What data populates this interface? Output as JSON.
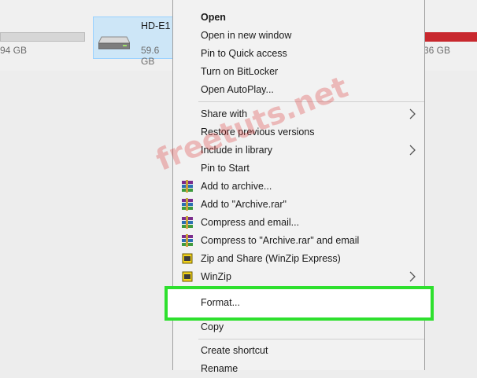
{
  "drives": {
    "left_size": "94 GB",
    "selected_name": "HD-E1",
    "selected_size": "59.6 GB",
    "right_size": "36 GB"
  },
  "menu": {
    "open": "Open",
    "open_new_window": "Open in new window",
    "pin_quick_access": "Pin to Quick access",
    "bitlocker": "Turn on BitLocker",
    "autoplay": "Open AutoPlay...",
    "share_with": "Share with",
    "restore_versions": "Restore previous versions",
    "include_library": "Include in library",
    "pin_start": "Pin to Start",
    "add_archive": "Add to archive...",
    "add_archive_rar": "Add to \"Archive.rar\"",
    "compress_email": "Compress and email...",
    "compress_rar_email": "Compress to \"Archive.rar\" and email",
    "zip_share": "Zip and Share (WinZip Express)",
    "winzip": "WinZip",
    "format": "Format...",
    "copy": "Copy",
    "create_shortcut": "Create shortcut",
    "rename": "Rename"
  },
  "watermark": "freetuts.net",
  "colors": {
    "highlight": "#2ee02e",
    "selection_bg": "#cde6f7",
    "drive_bar_full": "#c8282e"
  }
}
